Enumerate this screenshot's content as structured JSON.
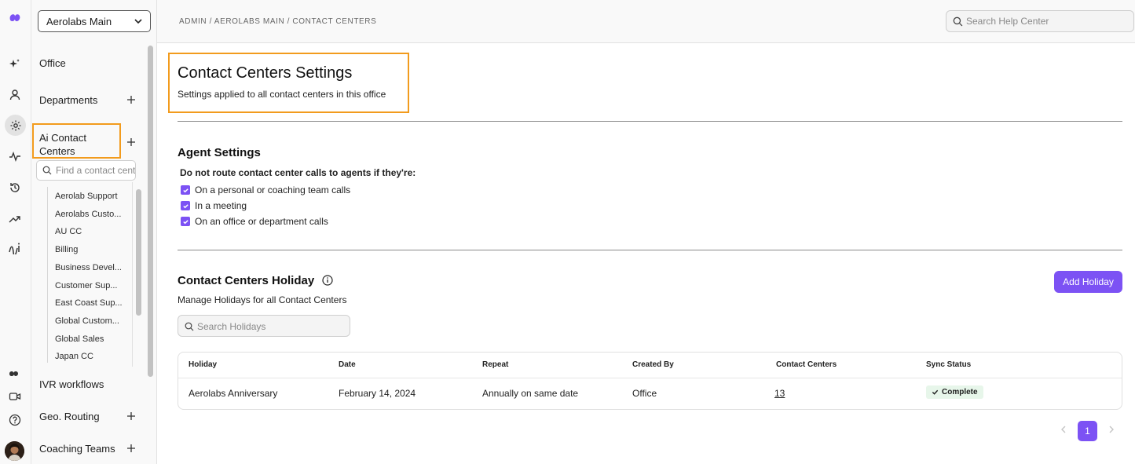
{
  "rail": {
    "icons": [
      "dialpad-logo-icon",
      "sparkle-icon",
      "person-icon",
      "gear-icon",
      "activity-icon",
      "history-icon",
      "trending-icon",
      "ai-icon",
      "megaphone-icon",
      "video-icon",
      "help-icon",
      "avatar"
    ]
  },
  "sidebar": {
    "office_selector": "Aerolabs Main",
    "items": {
      "office": "Office",
      "departments": "Departments",
      "ai_contact_centers": "Ai Contact Centers",
      "ivr_workflows": "IVR workflows",
      "geo_routing": "Geo. Routing",
      "coaching_teams": "Coaching Teams"
    },
    "contact_search_placeholder": "Find a contact center",
    "contact_centers": [
      "Aerolab Support",
      "Aerolabs Custo...",
      "AU CC",
      "Billing",
      "Business Devel...",
      "Customer Sup...",
      "East Coast Sup...",
      "Global Custom...",
      "Global Sales",
      "Japan CC"
    ]
  },
  "topbar": {
    "breadcrumb": "ADMIN / AEROLABS MAIN / CONTACT CENTERS",
    "help_search_placeholder": "Search Help Center"
  },
  "page": {
    "title": "Contact Centers Settings",
    "subtitle": "Settings applied to all contact centers in this office"
  },
  "agent_settings": {
    "title": "Agent Settings",
    "question": "Do not route contact center calls to agents if they're:",
    "options": [
      {
        "label": "On a personal or coaching team calls",
        "checked": true
      },
      {
        "label": "In a meeting",
        "checked": true
      },
      {
        "label": "On an office or department calls",
        "checked": true
      }
    ]
  },
  "holidays": {
    "title": "Contact Centers Holiday",
    "subtitle": "Manage Holidays for all Contact Centers",
    "add_button": "Add Holiday",
    "search_placeholder": "Search Holidays",
    "columns": [
      "Holiday",
      "Date",
      "Repeat",
      "Created By",
      "Contact Centers",
      "Sync Status"
    ],
    "rows": [
      {
        "holiday": "Aerolabs Anniversary",
        "date": "February 14, 2024",
        "repeat": "Annually on same date",
        "created_by": "Office",
        "contact_centers": "13",
        "sync_status": "Complete"
      }
    ],
    "pagination": {
      "current_page": "1"
    }
  },
  "colors": {
    "accent": "#7c52f4",
    "highlight": "#f29b1d",
    "status_bg": "#e7f6ea"
  }
}
